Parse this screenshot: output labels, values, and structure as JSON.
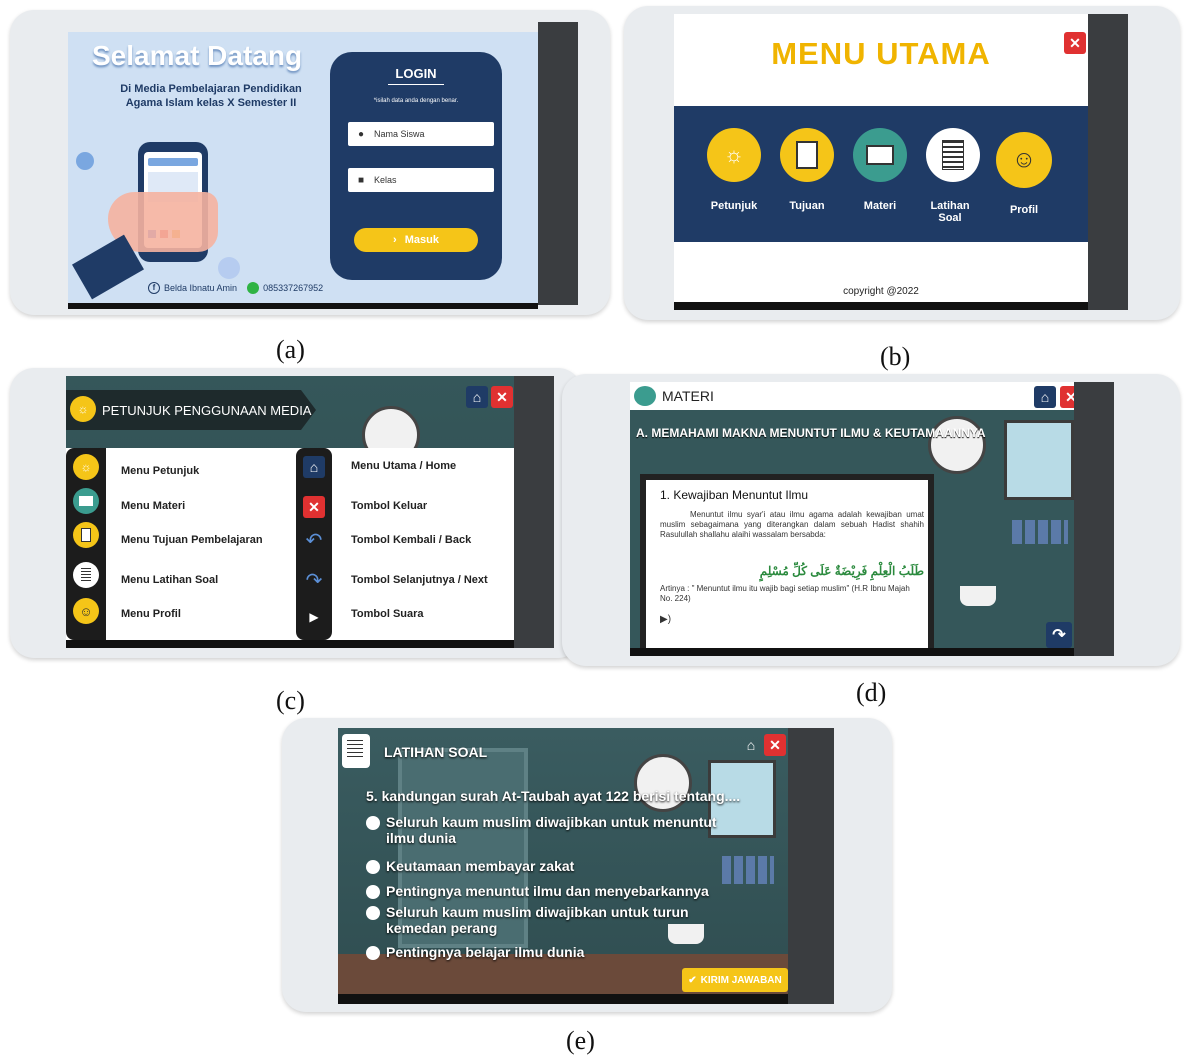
{
  "captions": {
    "a": "(a)",
    "b": "(b)",
    "c": "(c)",
    "d": "(d)",
    "e": "(e)"
  },
  "login": {
    "welcome": "Selamat Datang",
    "subtitle": "Di Media Pembelajaran Pendidikan Agama Islam kelas X Semester II",
    "title": "LOGIN",
    "hint": "*isilah data anda dengan benar.",
    "name_placeholder": "Nama Siswa",
    "class_placeholder": "Kelas",
    "submit": "Masuk",
    "author": "Belda Ibnatu Amin",
    "phone": "085337267952"
  },
  "main_menu": {
    "title": "MENU UTAMA",
    "items": [
      "Petunjuk",
      "Tujuan",
      "Materi",
      "Latihan Soal",
      "Profil"
    ],
    "copyright": "copyright @2022"
  },
  "guide": {
    "title": "PETUNJUK PENGGUNAAN MEDIA",
    "left": [
      "Menu Petunjuk",
      "Menu Materi",
      "Menu Tujuan Pembelajaran",
      "Menu Latihan Soal",
      "Menu Profil"
    ],
    "right": [
      "Menu Utama / Home",
      "Tombol Keluar",
      "Tombol Kembali / Back",
      "Tombol Selanjutnya / Next",
      "Tombol Suara"
    ]
  },
  "material": {
    "title": "MATERI",
    "heading": "A. MEMAHAMI MAKNA MENUNTUT ILMU & KEUTAMAANNYA",
    "card_title": "1. Kewajiban Menuntut Ilmu",
    "paragraph": "Menuntut ilmu syar'i atau ilmu agama adalah kewajiban umat muslim sebagaimana yang diterangkan dalam sebuah Hadist shahih Rasulullah shallahu alaihi wassalam bersabda:",
    "arabic": "طَلَبُ الْعِلْمِ فَرِيْضَةٌ عَلَى كُلِّ مُسْلِمٍ",
    "translation": "Artinya : \" Menuntut ilmu itu wajib bagi setiap muslim\" (H.R Ibnu Majah No. 224)"
  },
  "quiz": {
    "title": "LATIHAN SOAL",
    "question": "5. kandungan surah At-Taubah ayat 122 berisi tentang....",
    "options": [
      "Seluruh kaum muslim diwajibkan untuk menuntut ilmu dunia",
      "Keutamaan membayar zakat",
      "Pentingnya menuntut ilmu dan menyebarkannya",
      "Seluruh kaum muslim diwajibkan untuk turun kemedan perang",
      "Pentingnya belajar ilmu dunia"
    ],
    "submit": "KIRIM JAWABAN"
  },
  "colors": {
    "navy": "#1f3b66",
    "yellow": "#f5c518",
    "red": "#e03131",
    "teal": "#3b9c8f"
  }
}
